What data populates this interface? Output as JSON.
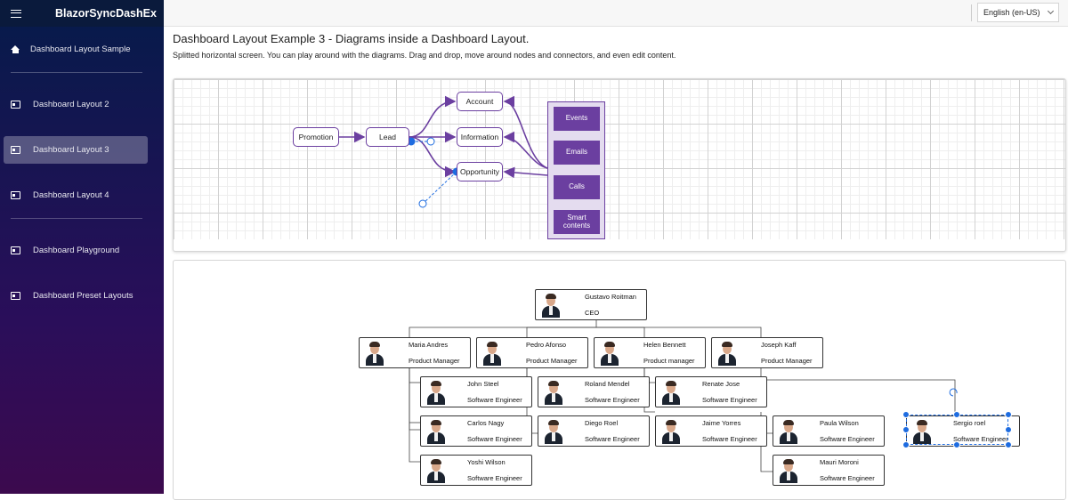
{
  "sidebar": {
    "brand": "BlazorSyncDashEx",
    "items": [
      {
        "label": "Dashboard Layout Sample"
      },
      {
        "label": "Dashboard Layout 2"
      },
      {
        "label": "Dashboard Layout 3"
      },
      {
        "label": "Dashboard Layout 4"
      },
      {
        "label": "Dashboard Playground"
      },
      {
        "label": "Dashboard Preset Layouts"
      }
    ],
    "active": "Dashboard Layout 3"
  },
  "topbar": {
    "language": "English (en-US)"
  },
  "page": {
    "title": "Dashboard Layout Example 3 - Diagrams inside a Dashboard Layout.",
    "subtitle": "Splitted horizontal screen. You can play around with the diagrams. Drag and drop, move around nodes and connectors, and even edit content."
  },
  "flow": {
    "nodes": {
      "promotion": "Promotion",
      "lead": "Lead",
      "account": "Account",
      "information": "Information",
      "opportunity": "Opportunity"
    },
    "swimlane": [
      "Events",
      "Emails",
      "Calls",
      "Smart contents"
    ],
    "accent": "#6b3fa0",
    "selection": "#1e6ce0"
  },
  "org": {
    "ceo": {
      "name": "Gustavo Roitman",
      "role": "CEO"
    },
    "managers": [
      {
        "name": "Maria Andres",
        "role": "Product Manager"
      },
      {
        "name": "Pedro Afonso",
        "role": "Product Manager"
      },
      {
        "name": "Helen Bennett",
        "role": "Product manager"
      },
      {
        "name": "Joseph Kaff",
        "role": "Product Manager"
      }
    ],
    "engineers": [
      {
        "name": "John Steel",
        "role": "Software Engineer"
      },
      {
        "name": "Roland Mendel",
        "role": "Software Engineer"
      },
      {
        "name": "Renate Jose",
        "role": "Software Engineer"
      },
      {
        "name": "Carlos Nagy",
        "role": "Software Engineer"
      },
      {
        "name": "Diego Roel",
        "role": "Software Engineer"
      },
      {
        "name": "Jaime Yorres",
        "role": "Software Engineer"
      },
      {
        "name": "Paula Wilson",
        "role": "Software Engineer"
      },
      {
        "name": "Sergio roel",
        "role": "Software Engineer"
      },
      {
        "name": "Yoshi Wilson",
        "role": "Software Engineer"
      },
      {
        "name": "Mauri Moroni",
        "role": "Software Engineer"
      }
    ]
  }
}
